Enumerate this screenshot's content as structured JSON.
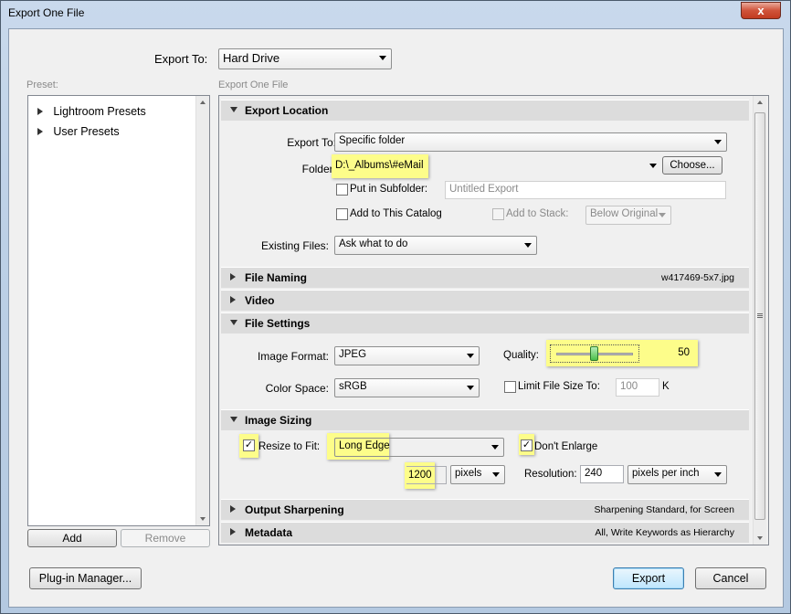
{
  "window": {
    "title": "Export One File",
    "close_label": "x"
  },
  "export_to": {
    "label": "Export To:",
    "value": "Hard Drive"
  },
  "preset": {
    "label": "Preset:",
    "items": [
      {
        "label": "Lightroom Presets"
      },
      {
        "label": "User Presets"
      }
    ],
    "add_label": "Add",
    "remove_label": "Remove"
  },
  "panel_label": "Export One File",
  "export_location": {
    "header": "Export Location",
    "export_to_label": "Export To:",
    "export_to_value": "Specific folder",
    "folder_label": "Folder:",
    "folder_value": "D:\\_Albums\\#eMail",
    "choose_label": "Choose...",
    "put_in_subfolder_label": "Put in Subfolder:",
    "put_in_subfolder_checked": false,
    "subfolder_placeholder": "Untitled Export",
    "add_to_catalog_label": "Add to This Catalog",
    "add_to_catalog_checked": false,
    "add_to_stack_label": "Add to Stack:",
    "add_to_stack_value": "Below Original",
    "existing_files_label": "Existing Files:",
    "existing_files_value": "Ask what to do"
  },
  "file_naming": {
    "header": "File Naming",
    "summary": "w417469-5x7.jpg"
  },
  "video": {
    "header": "Video"
  },
  "file_settings": {
    "header": "File Settings",
    "image_format_label": "Image Format:",
    "image_format_value": "JPEG",
    "quality_label": "Quality:",
    "quality_value": "50",
    "quality_fraction": 0.5,
    "color_space_label": "Color Space:",
    "color_space_value": "sRGB",
    "limit_size_label": "Limit File Size To:",
    "limit_size_checked": false,
    "limit_size_value": "100",
    "limit_size_unit": "K"
  },
  "image_sizing": {
    "header": "Image Sizing",
    "resize_label": "Resize to Fit:",
    "resize_checked": true,
    "resize_mode": "Long Edge",
    "dont_enlarge_label": "Don't Enlarge",
    "dont_enlarge_checked": true,
    "size_value": "1200",
    "size_unit": "pixels",
    "resolution_label": "Resolution:",
    "resolution_value": "240",
    "resolution_unit": "pixels per inch"
  },
  "output_sharpening": {
    "header": "Output Sharpening",
    "summary": "Sharpening Standard, for Screen"
  },
  "metadata": {
    "header": "Metadata",
    "summary": "All, Write Keywords as Hierarchy"
  },
  "footer": {
    "plugin_manager_label": "Plug-in Manager...",
    "export_label": "Export",
    "cancel_label": "Cancel"
  },
  "check_glyph": "✓",
  "colors": {
    "highlight": "#fdfd8a",
    "section_bg": "#dcdcdc",
    "primary_button": "#bee6fd"
  }
}
